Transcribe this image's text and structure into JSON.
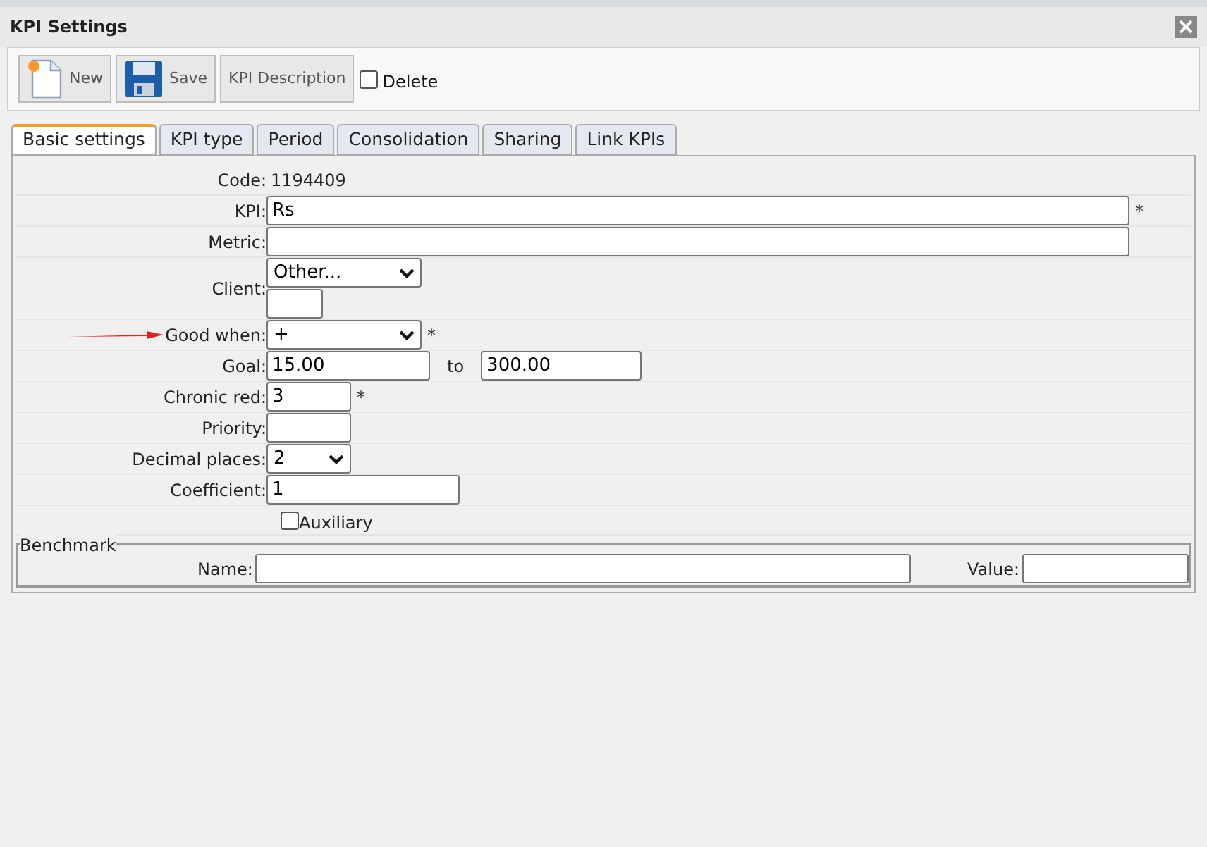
{
  "window": {
    "title": "KPI Settings"
  },
  "toolbar": {
    "buttons": [
      {
        "label": "New",
        "kind": "new"
      },
      {
        "label": "Save",
        "kind": "save"
      },
      {
        "label": "KPI Description",
        "kind": "plain"
      }
    ],
    "delete": {
      "label": "Delete",
      "checked": false
    }
  },
  "tabs": [
    {
      "label": "Basic settings",
      "selected": true
    },
    {
      "label": "KPI type",
      "selected": false
    },
    {
      "label": "Period",
      "selected": false
    },
    {
      "label": "Consolidation",
      "selected": false
    },
    {
      "label": "Sharing",
      "selected": false
    },
    {
      "label": "Link KPIs",
      "selected": false
    }
  ],
  "fields": [
    {
      "kind": "static",
      "label": "Code:",
      "value": "1194409"
    },
    {
      "kind": "text",
      "label": "KPI:",
      "value": "Rs",
      "required": "*"
    },
    {
      "kind": "text",
      "label": "Metric:"
    },
    {
      "kind": "client",
      "label": "Client:",
      "value": "Other..."
    },
    {
      "kind": "select",
      "label": "Good when:",
      "value": "+",
      "required": "*",
      "annotated": true
    },
    {
      "kind": "range",
      "label": "Goal:",
      "value": "15.00",
      "to_label": "to",
      "to_value": "300.00"
    },
    {
      "kind": "text",
      "label": "Chronic red:",
      "value": "3",
      "required": "*"
    },
    {
      "kind": "text",
      "label": "Priority:"
    },
    {
      "kind": "select",
      "label": "Decimal places:",
      "value": "2"
    },
    {
      "kind": "text",
      "label": "Coefficient:",
      "value": "1"
    },
    {
      "kind": "checkbox",
      "label": "Auxiliary",
      "checked": false
    }
  ],
  "benchmark": {
    "legend": "Benchmark",
    "name_label": "Name:",
    "value_label": "Value:"
  }
}
